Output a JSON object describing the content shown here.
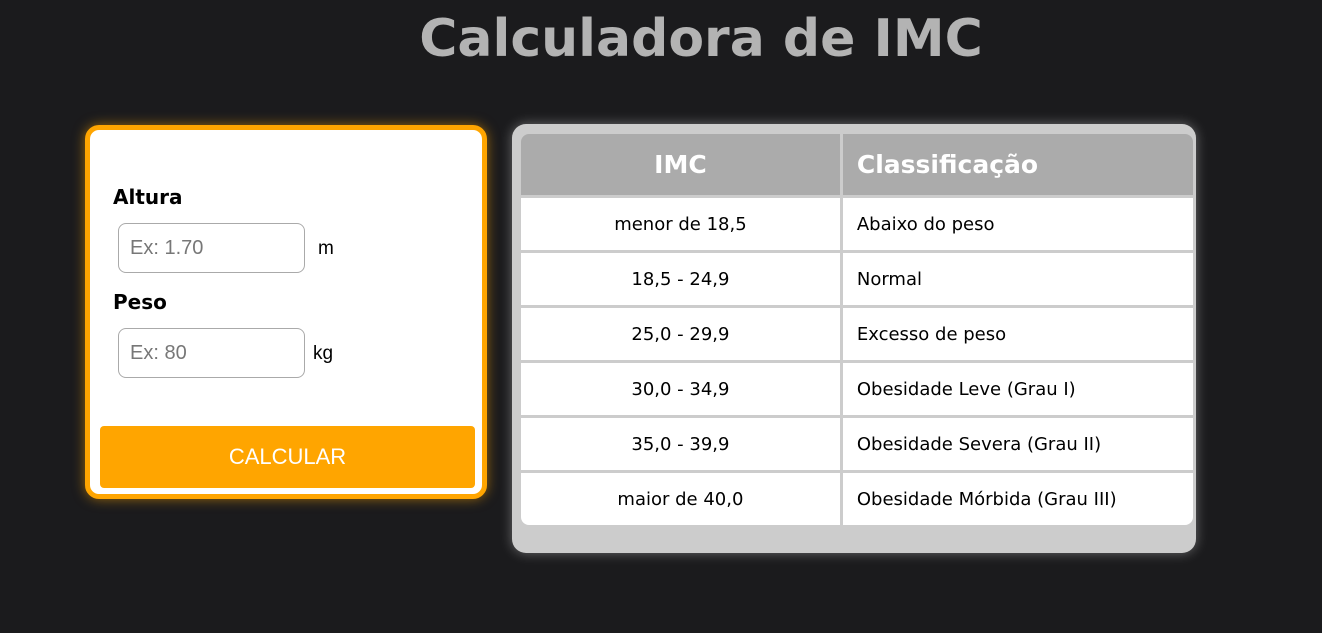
{
  "page": {
    "title": "Calculadora de IMC"
  },
  "form": {
    "height_label": "Altura",
    "height_placeholder": "Ex: 1.70",
    "height_unit": "m",
    "weight_label": "Peso",
    "weight_placeholder": "Ex: 80",
    "weight_unit": "kg",
    "button_label": "CALCULAR"
  },
  "table": {
    "headers": [
      "IMC",
      "Classificação"
    ],
    "rows": [
      [
        "menor de 18,5",
        "Abaixo do peso"
      ],
      [
        "18,5 - 24,9",
        "Normal"
      ],
      [
        "25,0 - 29,9",
        "Excesso de peso"
      ],
      [
        "30,0 - 34,9",
        "Obesidade Leve (Grau I)"
      ],
      [
        "35,0 - 39,9",
        "Obesidade Severa (Grau II)"
      ],
      [
        "maior de 40,0",
        "Obesidade Mórbida (Grau III)"
      ]
    ]
  },
  "colors": {
    "background": "#1b1b1d",
    "accent": "#ffa500",
    "title": "#b3b3b3",
    "table_header": "#ababab",
    "table_frame": "#cccccc"
  }
}
